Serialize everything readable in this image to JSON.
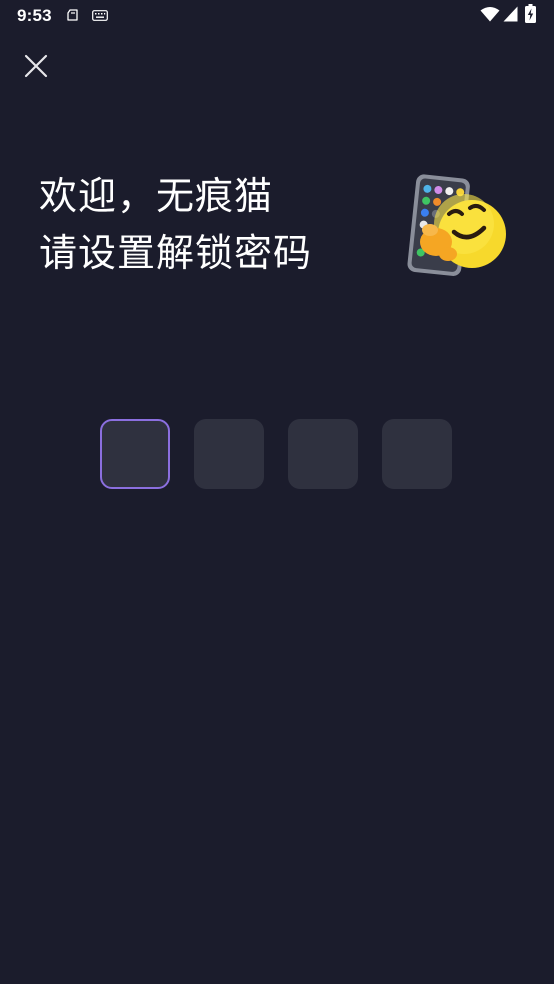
{
  "status_bar": {
    "time": "9:53",
    "icons": [
      "clipboard-icon",
      "keyboard-icon",
      "wifi-icon",
      "signal-icon",
      "battery-charging-icon"
    ]
  },
  "header": {
    "close_icon": "close-icon"
  },
  "welcome": {
    "line1": "欢迎，无痕猫",
    "line2": "请设置解锁密码",
    "illustration": "phone-hug-emoji-icon"
  },
  "pin": {
    "length": 4,
    "active_index": 0,
    "value": ""
  },
  "colors": {
    "background": "#1b1c2c",
    "pin_box": "#2f313f",
    "active_border": "#8b6fdf",
    "text": "#ffffff"
  }
}
